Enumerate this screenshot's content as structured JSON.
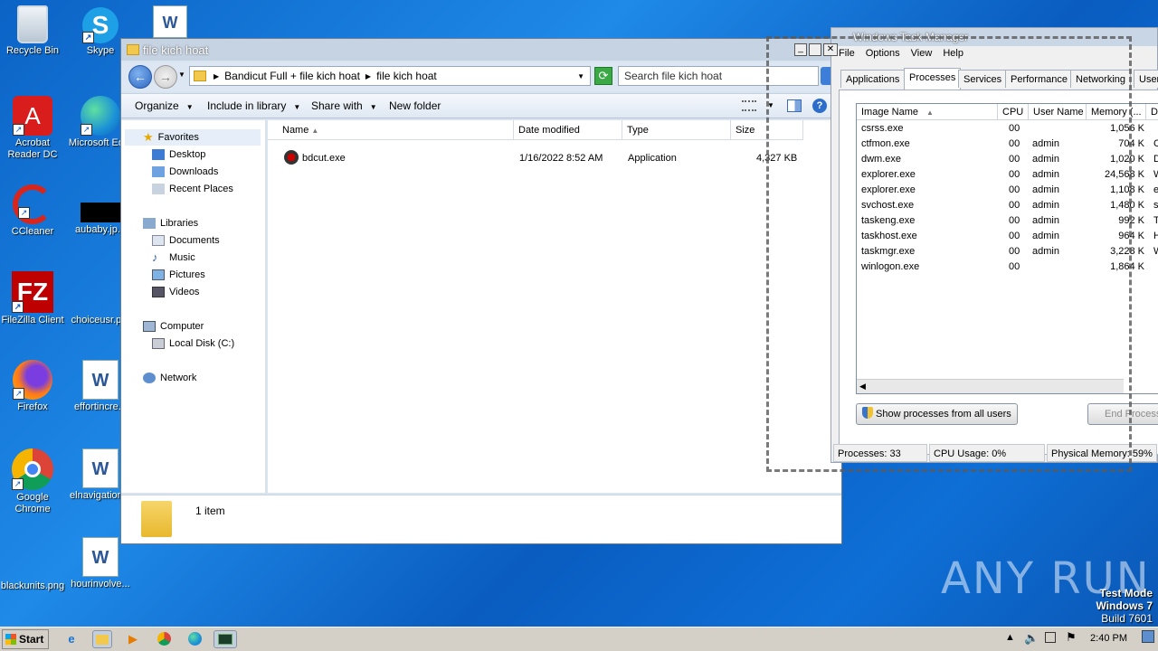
{
  "desktop": {
    "icons": [
      {
        "label": "Recycle Bin"
      },
      {
        "label": "Skype"
      },
      {
        "label": "Acrobat Reader DC"
      },
      {
        "label": "Microsoft Ed..."
      },
      {
        "label": "CCleaner"
      },
      {
        "label": "aubaby.jp..."
      },
      {
        "label": "FileZilla Client"
      },
      {
        "label": "choiceusr.p..."
      },
      {
        "label": "Firefox"
      },
      {
        "label": "effortincre..."
      },
      {
        "label": "Google Chrome"
      },
      {
        "label": "elnavigation..."
      },
      {
        "label": "blackunits.png"
      },
      {
        "label": "hourinvolve..."
      }
    ]
  },
  "explorer": {
    "title": "file kich hoat",
    "breadcrumb": [
      "Bandicut Full + file kich hoat",
      "file kich hoat"
    ],
    "search_placeholder": "Search file kich hoat",
    "toolbar": {
      "organize": "Organize",
      "include": "Include in library",
      "share": "Share with",
      "new_folder": "New folder"
    },
    "nav": {
      "favorites": "Favorites",
      "desktop": "Desktop",
      "downloads": "Downloads",
      "recent": "Recent Places",
      "libraries": "Libraries",
      "documents": "Documents",
      "music": "Music",
      "pictures": "Pictures",
      "videos": "Videos",
      "computer": "Computer",
      "local_disk": "Local Disk (C:)",
      "network": "Network"
    },
    "columns": {
      "name": "Name",
      "date": "Date modified",
      "type": "Type",
      "size": "Size"
    },
    "files": [
      {
        "name": "bdcut.exe",
        "date": "1/16/2022 8:52 AM",
        "type": "Application",
        "size": "4,327 KB"
      }
    ],
    "details": "1 item"
  },
  "taskmgr": {
    "title": "Windows Task Manager",
    "menu": {
      "file": "File",
      "options": "Options",
      "view": "View",
      "help": "Help"
    },
    "tabs": {
      "applications": "Applications",
      "processes": "Processes",
      "services": "Services",
      "performance": "Performance",
      "networking": "Networking",
      "users": "Users"
    },
    "columns": {
      "image": "Image Name",
      "cpu": "CPU",
      "user": "User Name",
      "memory": "Memory (..."
    },
    "processes": [
      {
        "name": "csrss.exe",
        "cpu": "00",
        "user": "",
        "mem": "1,056 K",
        "desc": ""
      },
      {
        "name": "ctfmon.exe",
        "cpu": "00",
        "user": "admin",
        "mem": "704 K",
        "desc": "C"
      },
      {
        "name": "dwm.exe",
        "cpu": "00",
        "user": "admin",
        "mem": "1,020 K",
        "desc": "D"
      },
      {
        "name": "explorer.exe",
        "cpu": "00",
        "user": "admin",
        "mem": "24,568 K",
        "desc": "W"
      },
      {
        "name": "explorer.exe",
        "cpu": "00",
        "user": "admin",
        "mem": "1,108 K",
        "desc": "e"
      },
      {
        "name": "svchost.exe",
        "cpu": "00",
        "user": "admin",
        "mem": "1,480 K",
        "desc": "s"
      },
      {
        "name": "taskeng.exe",
        "cpu": "00",
        "user": "admin",
        "mem": "992 K",
        "desc": "T"
      },
      {
        "name": "taskhost.exe",
        "cpu": "00",
        "user": "admin",
        "mem": "964 K",
        "desc": "H"
      },
      {
        "name": "taskmgr.exe",
        "cpu": "00",
        "user": "admin",
        "mem": "3,228 K",
        "desc": "W"
      },
      {
        "name": "winlogon.exe",
        "cpu": "00",
        "user": "",
        "mem": "1,864 K",
        "desc": ""
      }
    ],
    "show_all_button": "Show processes from all users",
    "end_process_button": "End Process",
    "status": {
      "processes": "Processes: 33",
      "cpu": "CPU Usage: 0%",
      "memory": "Physical Memory: 59%"
    }
  },
  "taskbar": {
    "start": "Start",
    "time": "2:40 PM"
  },
  "watermark": {
    "line1": "Test Mode",
    "line2": "Windows 7",
    "line3": "Build 7601",
    "brand": "ANY RUN"
  }
}
